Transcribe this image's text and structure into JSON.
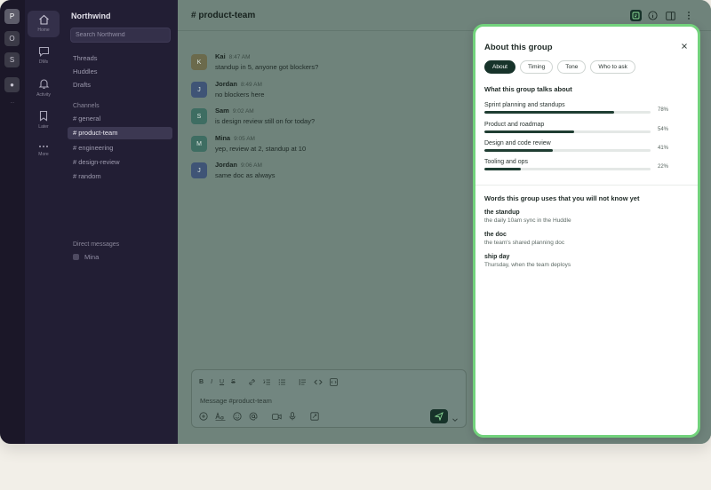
{
  "workspaces": {
    "items": [
      "P",
      "O",
      "S",
      "●"
    ],
    "more_label": "..."
  },
  "nav": [
    {
      "label": "Home",
      "icon": "home-icon"
    },
    {
      "label": "DMs",
      "icon": "message-icon"
    },
    {
      "label": "Activity",
      "icon": "bell-icon"
    },
    {
      "label": "Later",
      "icon": "bookmark-icon"
    },
    {
      "label": "More",
      "icon": "more-icon"
    }
  ],
  "sidebar": {
    "workspace_name": "Northwind",
    "search_placeholder": "Search Northwind",
    "links": [
      "Threads",
      "Huddles",
      "Drafts"
    ],
    "channels_label": "Channels",
    "channels": [
      "# general",
      "# product-team",
      "# engineering",
      "# design-review",
      "# random"
    ],
    "active_channel": 1,
    "dm_label": "Direct messages",
    "dms": [
      "Mina"
    ]
  },
  "channel": {
    "title": "# product-team",
    "messages": [
      {
        "author": "Kai",
        "initial": "K",
        "time": "8:47 AM",
        "text": "standup in 5, anyone got blockers?",
        "color": "#6b6a4c"
      },
      {
        "author": "Jordan",
        "initial": "J",
        "time": "8:49 AM",
        "text": "no blockers here",
        "color": "#3f5476"
      },
      {
        "author": "Sam",
        "initial": "S",
        "time": "9:02 AM",
        "text": "is design review still on for today?",
        "color": "#3e6d62"
      },
      {
        "author": "Mina",
        "initial": "M",
        "time": "9:05 AM",
        "text": "yep, review at 2, standup at 10",
        "color": "#3e6d62"
      },
      {
        "author": "Jordan",
        "initial": "J",
        "time": "9:06 AM",
        "text": "same doc as always",
        "color": "#3f5476"
      }
    ]
  },
  "composer": {
    "placeholder": "Message #product-team",
    "format_tools": [
      "B",
      "I",
      "U",
      "S"
    ]
  },
  "panel": {
    "title": "About this group",
    "tabs": [
      "About",
      "Timing",
      "Tone",
      "Who to ask"
    ],
    "active_tab": 0,
    "topics_title": "What this group talks about",
    "topics": [
      {
        "label": "Sprint planning and standups",
        "value": 78,
        "pct": "78%"
      },
      {
        "label": "Product and roadmap",
        "value": 54,
        "pct": "54%"
      },
      {
        "label": "Design and code review",
        "value": 41,
        "pct": "41%"
      },
      {
        "label": "Tooling and ops",
        "value": 22,
        "pct": "22%"
      }
    ],
    "words_title": "Words this group uses that you will not know yet",
    "words": [
      {
        "term": "the standup",
        "definition": "the daily 10am sync in the Huddle"
      },
      {
        "term": "the doc",
        "definition": "the team's shared planning doc"
      },
      {
        "term": "ship day",
        "definition": "Thursday, when the team deploys"
      }
    ]
  },
  "colors": {
    "accent": "#17332a",
    "panel_border": "#72d27c",
    "sidebar_bg": "#221e34"
  }
}
